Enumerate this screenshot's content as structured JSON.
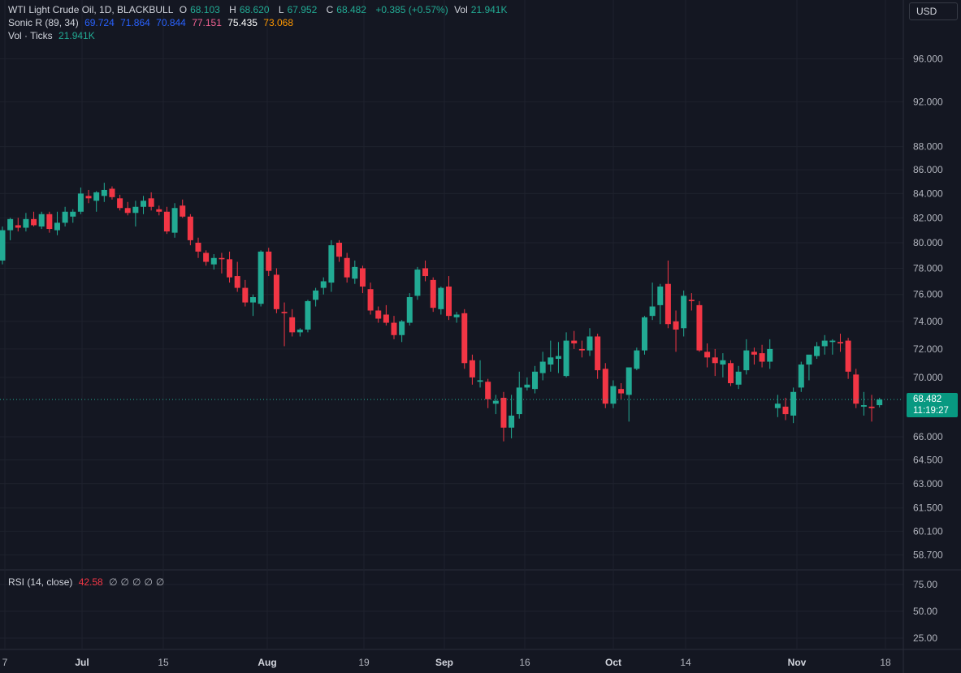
{
  "currency": "USD",
  "legend": {
    "symbol": "WTI Light Crude Oil, 1D, BLACKBULL",
    "open_label": "O",
    "open": "68.103",
    "high_label": "H",
    "high": "68.620",
    "low_label": "L",
    "low": "67.952",
    "close_label": "C",
    "close": "68.482",
    "change": "+0.385 (+0.57%)",
    "vol_label": "Vol",
    "vol": "21.941K"
  },
  "sonic": {
    "label": "Sonic R (89, 34)",
    "v1": "69.724",
    "v2": "71.864",
    "v3": "70.844",
    "v4": "77.151",
    "v5": "75.435",
    "v6": "73.068",
    "colors": [
      "#2962ff",
      "#2962ff",
      "#2962ff",
      "#f06292",
      "#ffffff",
      "#ff9800"
    ]
  },
  "volume": {
    "label": "Vol · Ticks",
    "value": "21.941K"
  },
  "rsi": {
    "label": "RSI (14, close)",
    "value": "42.58",
    "placeholders": [
      "∅",
      "∅",
      "∅",
      "∅",
      "∅"
    ]
  },
  "last_price": {
    "price": "68.482",
    "countdown": "11:19:27"
  },
  "colors": {
    "up": "#22ab94",
    "down": "#f23645",
    "background": "#141722",
    "grid": "#1e222d"
  },
  "chart_data": {
    "type": "candlestick",
    "price_axis_ticks": [
      "96.000",
      "92.000",
      "88.000",
      "86.000",
      "84.000",
      "82.000",
      "80.000",
      "78.000",
      "76.000",
      "74.000",
      "72.000",
      "70.000",
      "66.000",
      "64.500",
      "63.000",
      "61.500",
      "60.100",
      "58.700"
    ],
    "rsi_axis_ticks": [
      "75.00",
      "50.00",
      "25.00"
    ],
    "time_axis_ticks": [
      "7",
      "Jul",
      "15",
      "Aug",
      "19",
      "Sep",
      "16",
      "Oct",
      "14",
      "Nov",
      "18"
    ],
    "log_scale": true,
    "grid": true,
    "candles": [
      [
        78.6,
        81.3,
        78.3,
        81.0
      ],
      [
        81.0,
        82.0,
        80.2,
        81.9
      ],
      [
        81.4,
        82.0,
        80.9,
        81.2
      ],
      [
        81.2,
        82.4,
        80.9,
        81.9
      ],
      [
        81.9,
        82.5,
        81.3,
        81.4
      ],
      [
        81.3,
        82.5,
        81.1,
        82.3
      ],
      [
        82.3,
        82.5,
        80.8,
        81.1
      ],
      [
        81.0,
        82.5,
        80.6,
        81.6
      ],
      [
        81.6,
        82.9,
        81.3,
        82.5
      ],
      [
        82.1,
        82.7,
        81.6,
        82.5
      ],
      [
        82.5,
        84.5,
        82.3,
        84.0
      ],
      [
        83.8,
        84.3,
        83.2,
        83.6
      ],
      [
        83.4,
        84.2,
        82.5,
        84.1
      ],
      [
        83.8,
        84.9,
        83.3,
        84.3
      ],
      [
        84.4,
        84.6,
        83.5,
        83.7
      ],
      [
        83.6,
        83.9,
        82.6,
        82.8
      ],
      [
        82.8,
        83.3,
        82.2,
        82.4
      ],
      [
        82.4,
        83.4,
        81.3,
        82.9
      ],
      [
        82.9,
        83.8,
        82.3,
        83.4
      ],
      [
        83.6,
        84.1,
        82.6,
        82.9
      ],
      [
        82.7,
        83.0,
        82.2,
        82.5
      ],
      [
        82.5,
        82.9,
        80.7,
        80.9
      ],
      [
        80.8,
        83.2,
        80.4,
        82.8
      ],
      [
        83.0,
        83.5,
        82.0,
        82.1
      ],
      [
        82.1,
        82.3,
        79.8,
        80.2
      ],
      [
        80.0,
        80.4,
        78.8,
        79.3
      ],
      [
        79.2,
        79.4,
        78.2,
        78.5
      ],
      [
        78.3,
        79.1,
        77.9,
        78.8
      ],
      [
        78.8,
        79.2,
        77.6,
        78.7
      ],
      [
        78.7,
        79.3,
        76.9,
        77.3
      ],
      [
        77.4,
        78.5,
        76.2,
        76.5
      ],
      [
        76.5,
        77.1,
        75.1,
        75.4
      ],
      [
        75.4,
        76.0,
        74.4,
        75.8
      ],
      [
        75.3,
        79.4,
        75.1,
        79.3
      ],
      [
        79.3,
        79.6,
        77.4,
        77.8
      ],
      [
        77.5,
        78.0,
        74.6,
        74.9
      ],
      [
        74.7,
        75.4,
        72.2,
        74.6
      ],
      [
        74.3,
        74.9,
        72.9,
        73.2
      ],
      [
        73.2,
        73.5,
        72.9,
        73.4
      ],
      [
        73.4,
        75.6,
        73.2,
        75.5
      ],
      [
        75.6,
        76.5,
        75.1,
        76.3
      ],
      [
        76.5,
        77.3,
        76.0,
        77.0
      ],
      [
        76.9,
        80.2,
        76.2,
        79.8
      ],
      [
        80.0,
        80.2,
        78.5,
        78.9
      ],
      [
        78.8,
        79.2,
        76.9,
        77.3
      ],
      [
        77.2,
        78.6,
        76.8,
        78.1
      ],
      [
        78.0,
        78.2,
        76.1,
        76.6
      ],
      [
        76.4,
        76.9,
        74.5,
        74.8
      ],
      [
        74.8,
        75.1,
        73.9,
        74.2
      ],
      [
        74.5,
        75.2,
        73.7,
        73.9
      ],
      [
        73.9,
        74.4,
        72.7,
        73.0
      ],
      [
        73.0,
        74.1,
        72.5,
        74.0
      ],
      [
        73.9,
        76.1,
        73.7,
        75.8
      ],
      [
        75.9,
        78.1,
        75.6,
        77.9
      ],
      [
        78.0,
        78.6,
        77.0,
        77.4
      ],
      [
        77.1,
        77.3,
        74.7,
        75.0
      ],
      [
        74.9,
        76.6,
        74.5,
        76.5
      ],
      [
        76.6,
        77.4,
        74.1,
        74.4
      ],
      [
        74.3,
        74.7,
        73.9,
        74.5
      ],
      [
        74.6,
        74.9,
        70.6,
        71.0
      ],
      [
        71.2,
        71.6,
        69.5,
        70.0
      ],
      [
        69.7,
        71.2,
        69.3,
        69.8
      ],
      [
        69.7,
        69.9,
        67.9,
        68.5
      ],
      [
        68.2,
        68.8,
        67.5,
        68.4
      ],
      [
        68.6,
        69.0,
        65.7,
        66.6
      ],
      [
        66.6,
        68.8,
        65.9,
        67.4
      ],
      [
        67.5,
        70.4,
        67.2,
        69.3
      ],
      [
        69.3,
        70.0,
        69.1,
        69.5
      ],
      [
        69.2,
        70.8,
        68.9,
        70.4
      ],
      [
        70.3,
        71.8,
        69.8,
        71.1
      ],
      [
        70.9,
        72.6,
        70.4,
        71.4
      ],
      [
        71.3,
        72.5,
        70.3,
        71.5
      ],
      [
        70.1,
        73.2,
        70.0,
        72.6
      ],
      [
        72.6,
        73.3,
        72.0,
        72.4
      ],
      [
        72.0,
        72.6,
        71.4,
        71.9
      ],
      [
        71.9,
        73.5,
        71.5,
        72.9
      ],
      [
        72.9,
        73.1,
        69.9,
        70.5
      ],
      [
        70.6,
        71.0,
        67.9,
        68.2
      ],
      [
        68.2,
        69.8,
        67.9,
        69.4
      ],
      [
        69.2,
        69.6,
        68.5,
        68.9
      ],
      [
        68.8,
        70.3,
        67.0,
        70.7
      ],
      [
        70.6,
        72.1,
        70.5,
        71.9
      ],
      [
        71.9,
        74.4,
        71.6,
        74.3
      ],
      [
        74.4,
        76.9,
        74.1,
        75.1
      ],
      [
        75.2,
        76.8,
        73.8,
        76.6
      ],
      [
        76.8,
        78.6,
        73.5,
        73.8
      ],
      [
        74.0,
        74.8,
        71.8,
        73.4
      ],
      [
        73.5,
        76.3,
        72.9,
        75.9
      ],
      [
        75.6,
        76.1,
        74.8,
        75.5
      ],
      [
        75.2,
        75.5,
        71.8,
        71.9
      ],
      [
        71.8,
        72.4,
        70.7,
        71.4
      ],
      [
        71.4,
        72.0,
        70.1,
        71.0
      ],
      [
        70.9,
        71.7,
        70.0,
        71.2
      ],
      [
        71.0,
        71.2,
        69.4,
        69.6
      ],
      [
        69.5,
        70.8,
        69.2,
        70.4
      ],
      [
        70.5,
        72.7,
        70.2,
        71.9
      ],
      [
        71.8,
        72.1,
        70.9,
        71.6
      ],
      [
        71.7,
        72.3,
        70.7,
        71.1
      ],
      [
        71.1,
        72.7,
        70.6,
        72.0
      ],
      [
        67.9,
        68.8,
        67.3,
        68.2
      ],
      [
        68.0,
        68.6,
        67.1,
        67.5
      ],
      [
        67.4,
        69.3,
        66.9,
        69.0
      ],
      [
        69.3,
        71.1,
        69.0,
        70.9
      ],
      [
        70.9,
        71.4,
        69.8,
        71.6
      ],
      [
        71.5,
        72.5,
        71.3,
        72.2
      ],
      [
        72.2,
        73.0,
        71.6,
        72.6
      ],
      [
        72.5,
        72.7,
        71.6,
        72.6
      ],
      [
        72.5,
        73.1,
        71.8,
        72.4
      ],
      [
        72.6,
        72.8,
        69.9,
        70.4
      ],
      [
        70.2,
        70.6,
        67.9,
        68.2
      ],
      [
        68.0,
        69.0,
        67.4,
        68.1
      ],
      [
        68.0,
        68.8,
        67.0,
        67.9
      ],
      [
        68.1,
        68.6,
        67.95,
        68.482
      ]
    ]
  }
}
